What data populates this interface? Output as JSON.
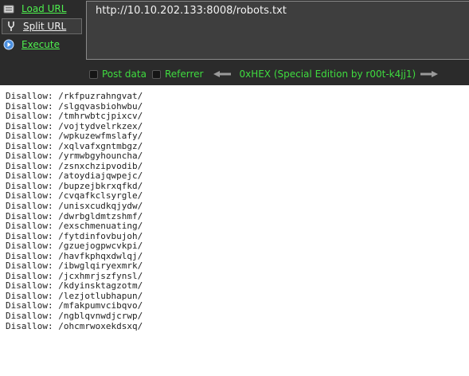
{
  "sidebar": {
    "load_url": {
      "label": "Load URL",
      "icon": "load-url-icon"
    },
    "split_url": {
      "label": "Split URL",
      "icon": "split-url-icon"
    },
    "execute": {
      "label": "Execute",
      "icon": "execute-icon"
    }
  },
  "url_field": {
    "value": "http://10.10.202.133:8008/robots.txt"
  },
  "options": {
    "post_data_label": "Post data",
    "referrer_label": "Referrer",
    "hex_label": "0xHEX (Special Edition by r00t-k4jj1)"
  },
  "colors": {
    "toolbar_bg": "#2b2b2b",
    "accent_green": "#4ef04e",
    "url_box_bg": "#3e3e3e"
  },
  "content": {
    "lines": [
      "Disallow: /rkfpuzrahngvat/",
      "Disallow: /slgqvasbiohwbu/",
      "Disallow: /tmhrwbtcjpixcv/",
      "Disallow: /vojtydvelrkzex/",
      "Disallow: /wpkuzewfmslafy/",
      "Disallow: /xqlvafxgntmbgz/",
      "Disallow: /yrmwbgyhouncha/",
      "Disallow: /zsnxchzipvodib/",
      "Disallow: /atoydiajqwpejc/",
      "Disallow: /bupzejbkrxqfkd/",
      "Disallow: /cvqafkclsyrgle/",
      "Disallow: /unisxcudkqjydw/",
      "Disallow: /dwrbgldmtzshmf/",
      "Disallow: /exschmenuating/",
      "Disallow: /fytdinfovbujoh/",
      "Disallow: /gzuejogpwcvkpi/",
      "Disallow: /havfkphqxdwlqj/",
      "Disallow: /ibwglqiryexmrk/",
      "Disallow: /jcxhmrjszfynsl/",
      "Disallow: /kdyinsktagzotm/",
      "Disallow: /lezjotlubhapun/",
      "Disallow: /mfakpumvcibqvo/",
      "Disallow: /ngblqvnwdjcrwp/",
      "Disallow: /ohcmrwoxekdsxq/"
    ]
  }
}
